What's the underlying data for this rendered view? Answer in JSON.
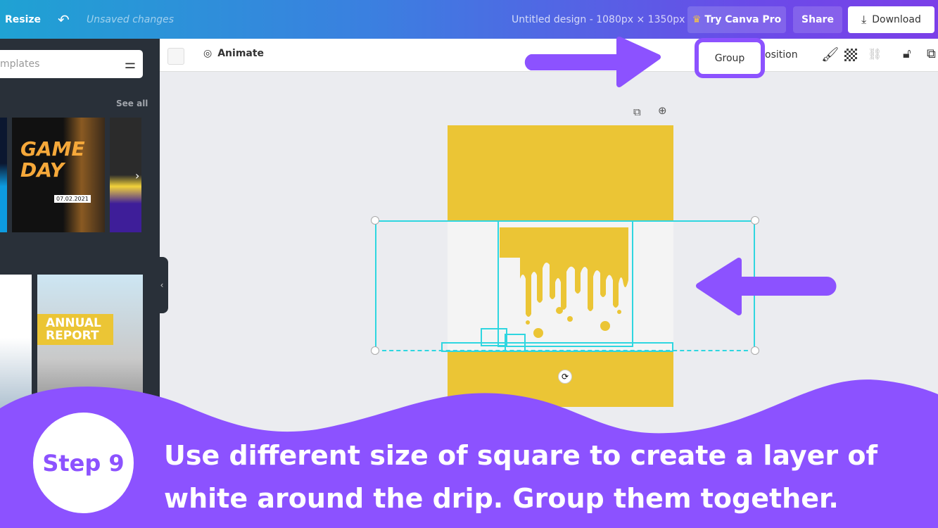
{
  "topbar": {
    "resize": "Resize",
    "unsaved": "Unsaved changes",
    "title": "Untitled design - 1080px × 1350px",
    "try_pro": "Try Canva Pro",
    "share": "Share",
    "download": "Download"
  },
  "sidebar": {
    "search_placeholder": "mplates",
    "see_all": "See all",
    "templates": [
      {
        "title": "GAME DAY",
        "date": "07.02.2021"
      },
      {
        "title": "ANNUAL REPORT"
      }
    ]
  },
  "toolbar": {
    "animate": "Animate",
    "group": "Group",
    "position": "osition"
  },
  "caption": {
    "step": "Step 9",
    "line1": "Use different size of square to create a layer of",
    "line2": "white around the drip. Group them together."
  },
  "colors": {
    "accent": "#8c52ff",
    "design_yellow": "#ebc535",
    "selection": "#2fd6e0"
  }
}
